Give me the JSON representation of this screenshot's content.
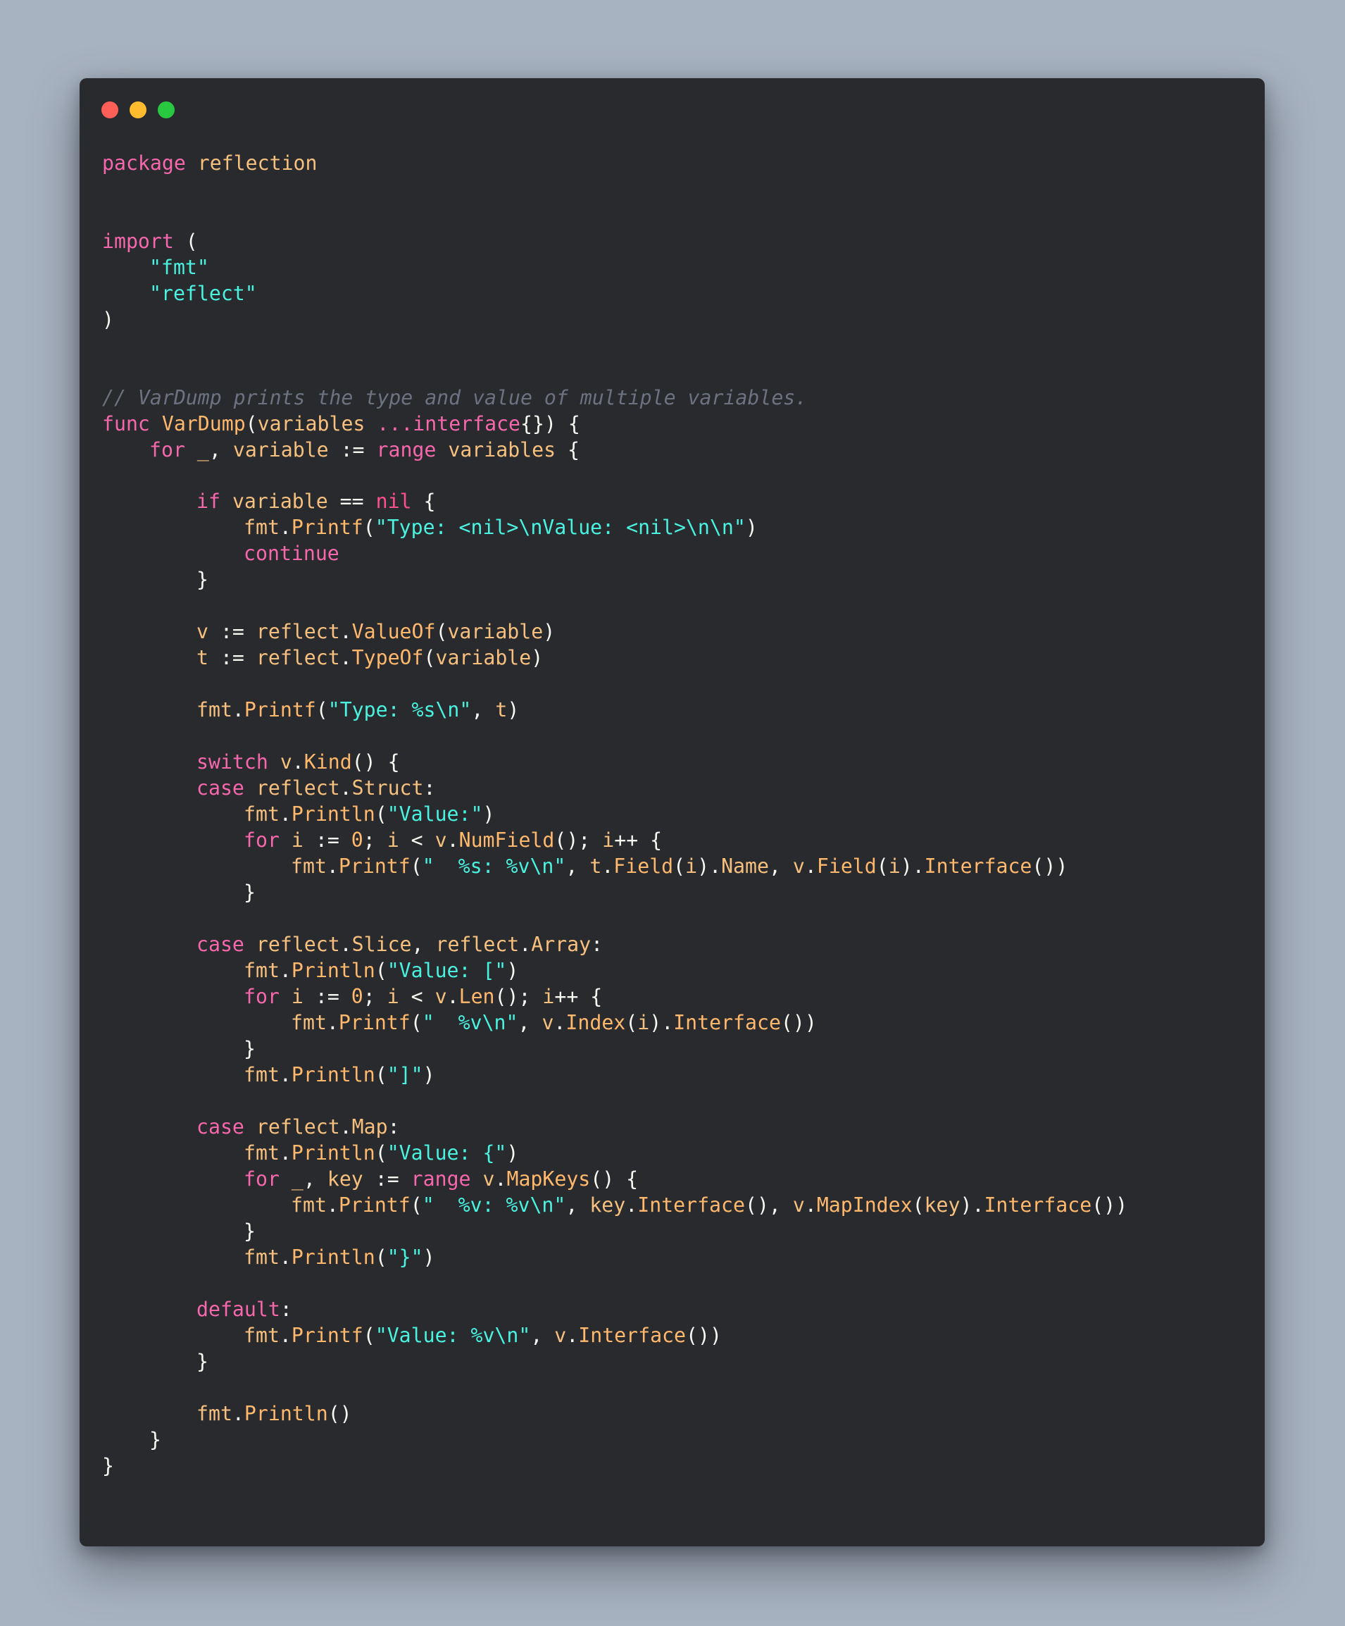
{
  "window": {
    "controls": [
      "close",
      "minimize",
      "maximize"
    ]
  },
  "code": {
    "language": "go",
    "lines": [
      {
        "row": 0,
        "indent": 0,
        "tokens": [
          [
            "kw",
            "package"
          ],
          [
            "pn",
            " "
          ],
          [
            "id",
            "reflection"
          ]
        ]
      },
      {
        "row": 3,
        "indent": 0,
        "tokens": [
          [
            "kw",
            "import"
          ],
          [
            "pn",
            " ("
          ]
        ]
      },
      {
        "row": 4,
        "indent": 1,
        "tokens": [
          [
            "str",
            "\"fmt\""
          ]
        ]
      },
      {
        "row": 5,
        "indent": 1,
        "tokens": [
          [
            "str",
            "\"reflect\""
          ]
        ]
      },
      {
        "row": 6,
        "indent": 0,
        "tokens": [
          [
            "pn",
            ")"
          ]
        ]
      },
      {
        "row": 9,
        "indent": 0,
        "tokens": [
          [
            "cm",
            "// VarDump prints the type and value of multiple variables."
          ]
        ]
      },
      {
        "row": 10,
        "indent": 0,
        "tokens": [
          [
            "kw",
            "func"
          ],
          [
            "pn",
            " "
          ],
          [
            "fn",
            "VarDump"
          ],
          [
            "pn",
            "("
          ],
          [
            "id",
            "variables"
          ],
          [
            "pn",
            " "
          ],
          [
            "kw",
            "...interface"
          ],
          [
            "pn",
            "{}) {"
          ]
        ]
      },
      {
        "row": 11,
        "indent": 1,
        "tokens": [
          [
            "kw",
            "for"
          ],
          [
            "pn",
            " "
          ],
          [
            "id",
            "_"
          ],
          [
            "pn",
            ", "
          ],
          [
            "id",
            "variable"
          ],
          [
            "pn",
            " := "
          ],
          [
            "kw",
            "range"
          ],
          [
            "pn",
            " "
          ],
          [
            "id",
            "variables"
          ],
          [
            "pn",
            " {"
          ]
        ]
      },
      {
        "row": 13,
        "indent": 2,
        "tokens": [
          [
            "kw",
            "if"
          ],
          [
            "pn",
            " "
          ],
          [
            "id",
            "variable"
          ],
          [
            "pn",
            " == "
          ],
          [
            "nil",
            "nil"
          ],
          [
            "pn",
            " {"
          ]
        ]
      },
      {
        "row": 14,
        "indent": 3,
        "tokens": [
          [
            "id",
            "fmt"
          ],
          [
            "pn",
            "."
          ],
          [
            "fn",
            "Printf"
          ],
          [
            "pn",
            "("
          ],
          [
            "str",
            "\"Type: <nil>\\nValue: <nil>\\n\\n\""
          ],
          [
            "pn",
            ")"
          ]
        ]
      },
      {
        "row": 15,
        "indent": 3,
        "tokens": [
          [
            "kw",
            "continue"
          ]
        ]
      },
      {
        "row": 16,
        "indent": 2,
        "tokens": [
          [
            "pn",
            "}"
          ]
        ]
      },
      {
        "row": 18,
        "indent": 2,
        "tokens": [
          [
            "id",
            "v"
          ],
          [
            "pn",
            " := "
          ],
          [
            "id",
            "reflect"
          ],
          [
            "pn",
            "."
          ],
          [
            "fn",
            "ValueOf"
          ],
          [
            "pn",
            "("
          ],
          [
            "id",
            "variable"
          ],
          [
            "pn",
            ")"
          ]
        ]
      },
      {
        "row": 19,
        "indent": 2,
        "tokens": [
          [
            "id",
            "t"
          ],
          [
            "pn",
            " := "
          ],
          [
            "id",
            "reflect"
          ],
          [
            "pn",
            "."
          ],
          [
            "fn",
            "TypeOf"
          ],
          [
            "pn",
            "("
          ],
          [
            "id",
            "variable"
          ],
          [
            "pn",
            ")"
          ]
        ]
      },
      {
        "row": 21,
        "indent": 2,
        "tokens": [
          [
            "id",
            "fmt"
          ],
          [
            "pn",
            "."
          ],
          [
            "fn",
            "Printf"
          ],
          [
            "pn",
            "("
          ],
          [
            "str",
            "\"Type: %s\\n\""
          ],
          [
            "pn",
            ", "
          ],
          [
            "id",
            "t"
          ],
          [
            "pn",
            ")"
          ]
        ]
      },
      {
        "row": 23,
        "indent": 2,
        "tokens": [
          [
            "kw",
            "switch"
          ],
          [
            "pn",
            " "
          ],
          [
            "id",
            "v"
          ],
          [
            "pn",
            "."
          ],
          [
            "fn",
            "Kind"
          ],
          [
            "pn",
            "() {"
          ]
        ]
      },
      {
        "row": 24,
        "indent": 2,
        "tokens": [
          [
            "kw",
            "case"
          ],
          [
            "pn",
            " "
          ],
          [
            "id",
            "reflect"
          ],
          [
            "pn",
            "."
          ],
          [
            "id",
            "Struct"
          ],
          [
            "pn",
            ":"
          ]
        ]
      },
      {
        "row": 25,
        "indent": 3,
        "tokens": [
          [
            "id",
            "fmt"
          ],
          [
            "pn",
            "."
          ],
          [
            "fn",
            "Println"
          ],
          [
            "pn",
            "("
          ],
          [
            "str",
            "\"Value:\""
          ],
          [
            "pn",
            ")"
          ]
        ]
      },
      {
        "row": 26,
        "indent": 3,
        "tokens": [
          [
            "kw",
            "for"
          ],
          [
            "pn",
            " "
          ],
          [
            "id",
            "i"
          ],
          [
            "pn",
            " := "
          ],
          [
            "num",
            "0"
          ],
          [
            "pn",
            "; "
          ],
          [
            "id",
            "i"
          ],
          [
            "pn",
            " < "
          ],
          [
            "id",
            "v"
          ],
          [
            "pn",
            "."
          ],
          [
            "fn",
            "NumField"
          ],
          [
            "pn",
            "(); "
          ],
          [
            "id",
            "i"
          ],
          [
            "pn",
            "++ {"
          ]
        ]
      },
      {
        "row": 27,
        "indent": 4,
        "tokens": [
          [
            "id",
            "fmt"
          ],
          [
            "pn",
            "."
          ],
          [
            "fn",
            "Printf"
          ],
          [
            "pn",
            "("
          ],
          [
            "str",
            "\"  %s: %v\\n\""
          ],
          [
            "pn",
            ", "
          ],
          [
            "id",
            "t"
          ],
          [
            "pn",
            "."
          ],
          [
            "fn",
            "Field"
          ],
          [
            "pn",
            "("
          ],
          [
            "id",
            "i"
          ],
          [
            "pn",
            ")."
          ],
          [
            "id",
            "Name"
          ],
          [
            "pn",
            ", "
          ],
          [
            "id",
            "v"
          ],
          [
            "pn",
            "."
          ],
          [
            "fn",
            "Field"
          ],
          [
            "pn",
            "("
          ],
          [
            "id",
            "i"
          ],
          [
            "pn",
            ")."
          ],
          [
            "fn",
            "Interface"
          ],
          [
            "pn",
            "())"
          ]
        ]
      },
      {
        "row": 28,
        "indent": 3,
        "tokens": [
          [
            "pn",
            "}"
          ]
        ]
      },
      {
        "row": 30,
        "indent": 2,
        "tokens": [
          [
            "kw",
            "case"
          ],
          [
            "pn",
            " "
          ],
          [
            "id",
            "reflect"
          ],
          [
            "pn",
            "."
          ],
          [
            "id",
            "Slice"
          ],
          [
            "pn",
            ", "
          ],
          [
            "id",
            "reflect"
          ],
          [
            "pn",
            "."
          ],
          [
            "id",
            "Array"
          ],
          [
            "pn",
            ":"
          ]
        ]
      },
      {
        "row": 31,
        "indent": 3,
        "tokens": [
          [
            "id",
            "fmt"
          ],
          [
            "pn",
            "."
          ],
          [
            "fn",
            "Println"
          ],
          [
            "pn",
            "("
          ],
          [
            "str",
            "\"Value: [\""
          ],
          [
            "pn",
            ")"
          ]
        ]
      },
      {
        "row": 32,
        "indent": 3,
        "tokens": [
          [
            "kw",
            "for"
          ],
          [
            "pn",
            " "
          ],
          [
            "id",
            "i"
          ],
          [
            "pn",
            " := "
          ],
          [
            "num",
            "0"
          ],
          [
            "pn",
            "; "
          ],
          [
            "id",
            "i"
          ],
          [
            "pn",
            " < "
          ],
          [
            "id",
            "v"
          ],
          [
            "pn",
            "."
          ],
          [
            "fn",
            "Len"
          ],
          [
            "pn",
            "(); "
          ],
          [
            "id",
            "i"
          ],
          [
            "pn",
            "++ {"
          ]
        ]
      },
      {
        "row": 33,
        "indent": 4,
        "tokens": [
          [
            "id",
            "fmt"
          ],
          [
            "pn",
            "."
          ],
          [
            "fn",
            "Printf"
          ],
          [
            "pn",
            "("
          ],
          [
            "str",
            "\"  %v\\n\""
          ],
          [
            "pn",
            ", "
          ],
          [
            "id",
            "v"
          ],
          [
            "pn",
            "."
          ],
          [
            "fn",
            "Index"
          ],
          [
            "pn",
            "("
          ],
          [
            "id",
            "i"
          ],
          [
            "pn",
            ")."
          ],
          [
            "fn",
            "Interface"
          ],
          [
            "pn",
            "())"
          ]
        ]
      },
      {
        "row": 34,
        "indent": 3,
        "tokens": [
          [
            "pn",
            "}"
          ]
        ]
      },
      {
        "row": 35,
        "indent": 3,
        "tokens": [
          [
            "id",
            "fmt"
          ],
          [
            "pn",
            "."
          ],
          [
            "fn",
            "Println"
          ],
          [
            "pn",
            "("
          ],
          [
            "str",
            "\"]\""
          ],
          [
            "pn",
            ")"
          ]
        ]
      },
      {
        "row": 37,
        "indent": 2,
        "tokens": [
          [
            "kw",
            "case"
          ],
          [
            "pn",
            " "
          ],
          [
            "id",
            "reflect"
          ],
          [
            "pn",
            "."
          ],
          [
            "id",
            "Map"
          ],
          [
            "pn",
            ":"
          ]
        ]
      },
      {
        "row": 38,
        "indent": 3,
        "tokens": [
          [
            "id",
            "fmt"
          ],
          [
            "pn",
            "."
          ],
          [
            "fn",
            "Println"
          ],
          [
            "pn",
            "("
          ],
          [
            "str",
            "\"Value: {\""
          ],
          [
            "pn",
            ")"
          ]
        ]
      },
      {
        "row": 39,
        "indent": 3,
        "tokens": [
          [
            "kw",
            "for"
          ],
          [
            "pn",
            " "
          ],
          [
            "id",
            "_"
          ],
          [
            "pn",
            ", "
          ],
          [
            "id",
            "key"
          ],
          [
            "pn",
            " := "
          ],
          [
            "kw",
            "range"
          ],
          [
            "pn",
            " "
          ],
          [
            "id",
            "v"
          ],
          [
            "pn",
            "."
          ],
          [
            "fn",
            "MapKeys"
          ],
          [
            "pn",
            "() {"
          ]
        ]
      },
      {
        "row": 40,
        "indent": 4,
        "tokens": [
          [
            "id",
            "fmt"
          ],
          [
            "pn",
            "."
          ],
          [
            "fn",
            "Printf"
          ],
          [
            "pn",
            "("
          ],
          [
            "str",
            "\"  %v: %v\\n\""
          ],
          [
            "pn",
            ", "
          ],
          [
            "id",
            "key"
          ],
          [
            "pn",
            "."
          ],
          [
            "fn",
            "Interface"
          ],
          [
            "pn",
            "(), "
          ],
          [
            "id",
            "v"
          ],
          [
            "pn",
            "."
          ],
          [
            "fn",
            "MapIndex"
          ],
          [
            "pn",
            "("
          ],
          [
            "id",
            "key"
          ],
          [
            "pn",
            ")."
          ],
          [
            "fn",
            "Interface"
          ],
          [
            "pn",
            "())"
          ]
        ]
      },
      {
        "row": 41,
        "indent": 3,
        "tokens": [
          [
            "pn",
            "}"
          ]
        ]
      },
      {
        "row": 42,
        "indent": 3,
        "tokens": [
          [
            "id",
            "fmt"
          ],
          [
            "pn",
            "."
          ],
          [
            "fn",
            "Println"
          ],
          [
            "pn",
            "("
          ],
          [
            "str",
            "\"}\""
          ],
          [
            "pn",
            ")"
          ]
        ]
      },
      {
        "row": 44,
        "indent": 2,
        "tokens": [
          [
            "kw",
            "default"
          ],
          [
            "pn",
            ":"
          ]
        ]
      },
      {
        "row": 45,
        "indent": 3,
        "tokens": [
          [
            "id",
            "fmt"
          ],
          [
            "pn",
            "."
          ],
          [
            "fn",
            "Printf"
          ],
          [
            "pn",
            "("
          ],
          [
            "str",
            "\"Value: %v\\n\""
          ],
          [
            "pn",
            ", "
          ],
          [
            "id",
            "v"
          ],
          [
            "pn",
            "."
          ],
          [
            "fn",
            "Interface"
          ],
          [
            "pn",
            "())"
          ]
        ]
      },
      {
        "row": 46,
        "indent": 2,
        "tokens": [
          [
            "pn",
            "}"
          ]
        ]
      },
      {
        "row": 48,
        "indent": 2,
        "tokens": [
          [
            "id",
            "fmt"
          ],
          [
            "pn",
            "."
          ],
          [
            "fn",
            "Println"
          ],
          [
            "pn",
            "()"
          ]
        ]
      },
      {
        "row": 49,
        "indent": 1,
        "tokens": [
          [
            "pn",
            "}"
          ]
        ]
      },
      {
        "row": 50,
        "indent": 0,
        "tokens": [
          [
            "pn",
            "}"
          ]
        ]
      }
    ]
  }
}
